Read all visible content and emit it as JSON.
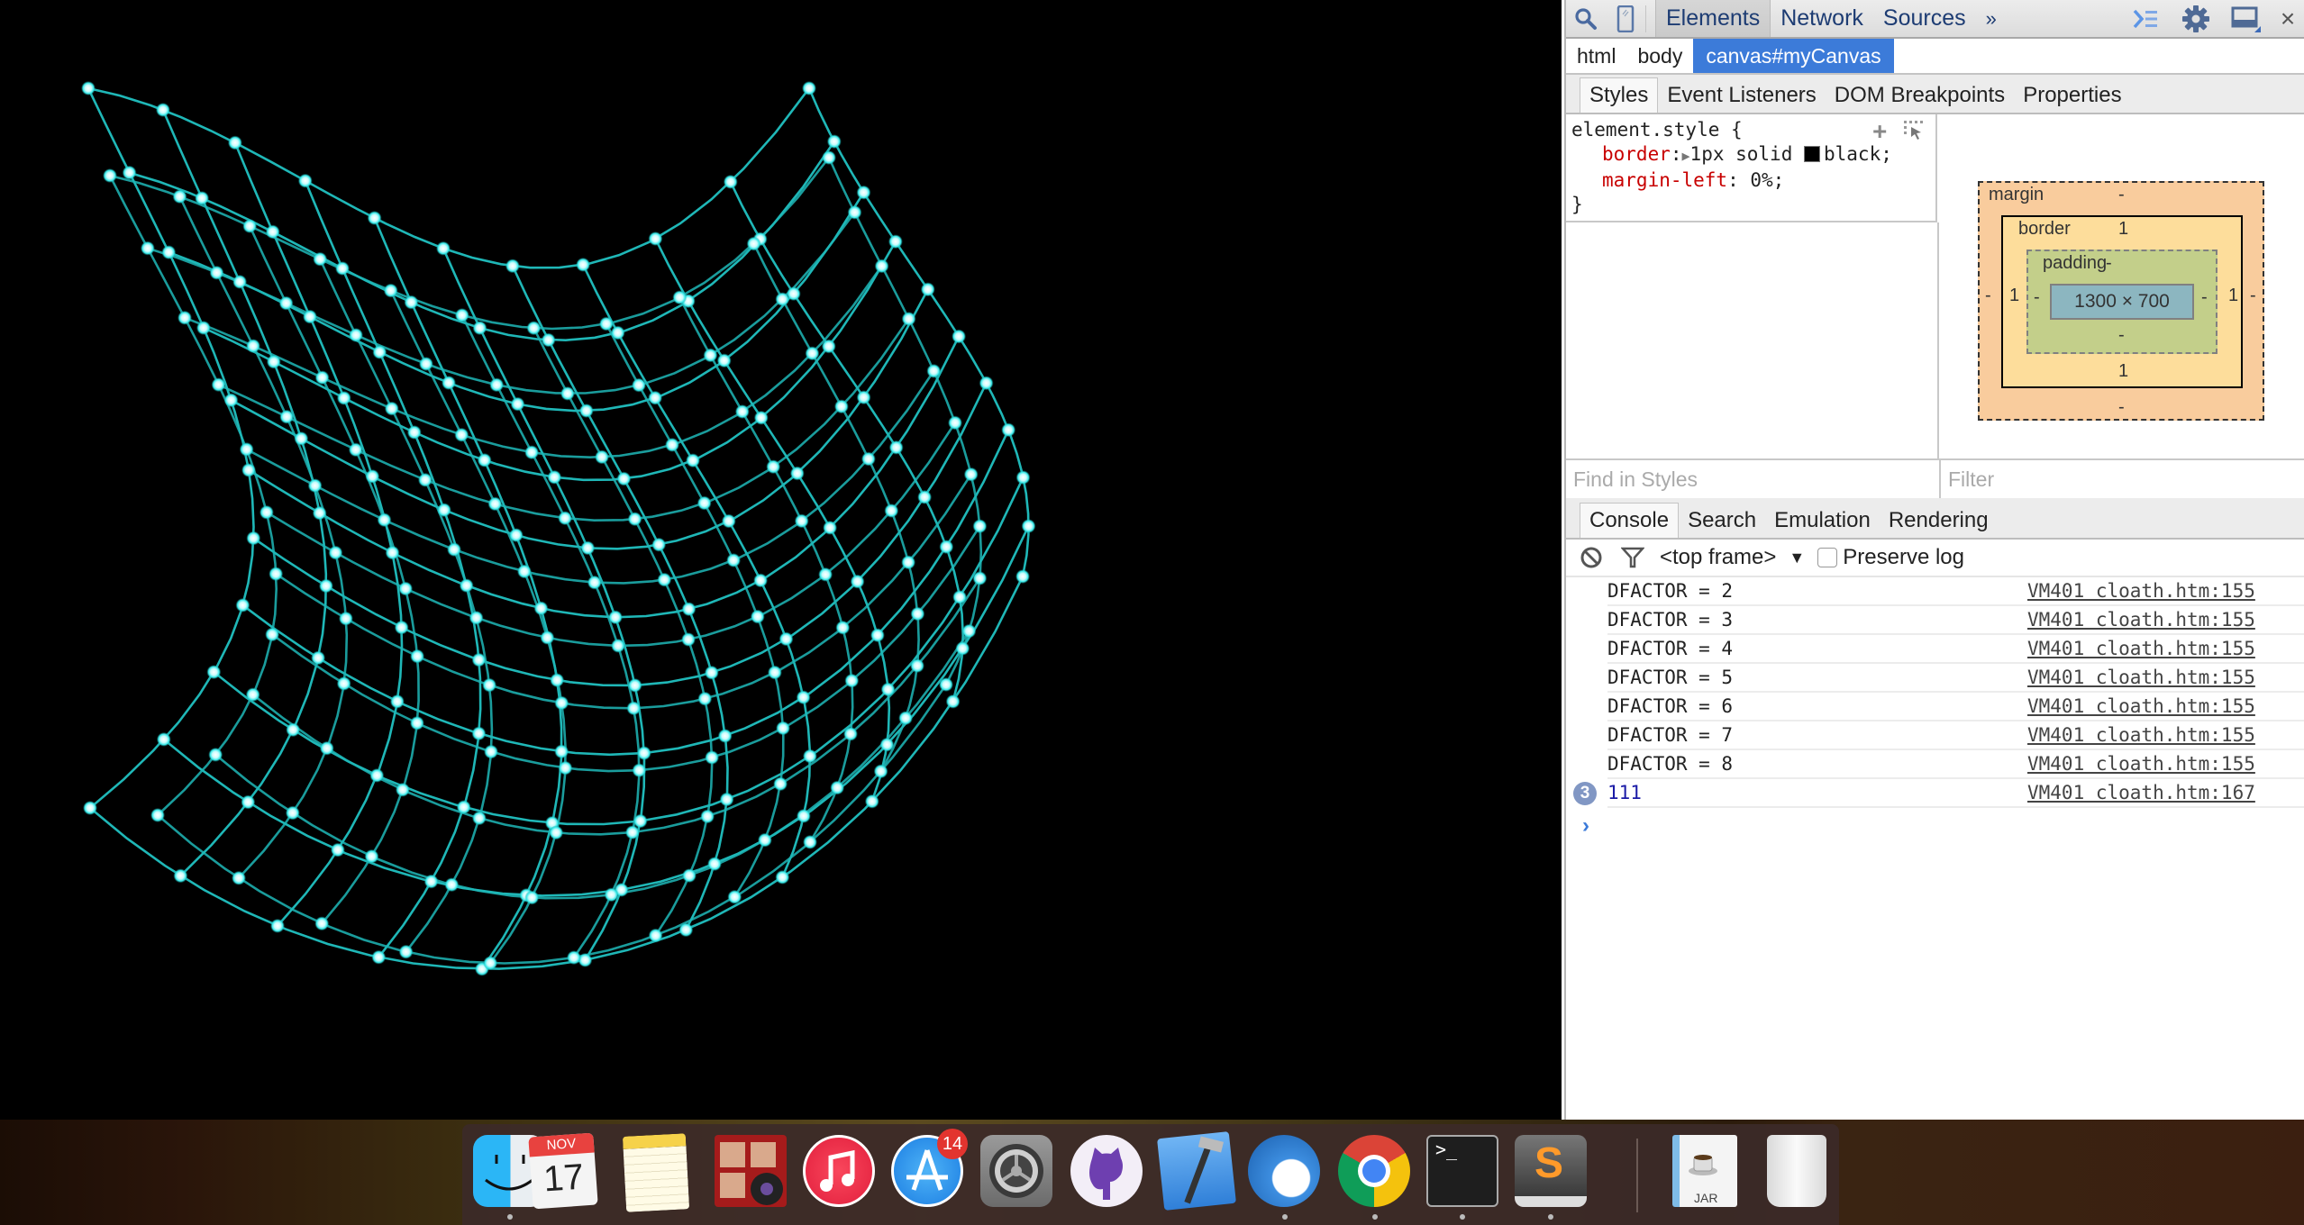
{
  "canvas": {
    "element_id": "myCanvas",
    "background": "#000000",
    "mesh_line_color": "#1fb7b7",
    "mesh_node_color": "#3ff0f0",
    "mesh_node_core": "#ffffff"
  },
  "devtools": {
    "toolbar": {
      "search_icon": "search-icon",
      "device_icon": "device-mode-icon",
      "tabs": [
        {
          "label": "Elements",
          "active": true
        },
        {
          "label": "Network",
          "active": false
        },
        {
          "label": "Sources",
          "active": false
        }
      ],
      "more_tabs": "»",
      "right_icons": [
        "console-drawer-icon",
        "gear-icon",
        "dock-side-icon",
        "close-icon"
      ],
      "close_label": "×"
    },
    "breadcrumbs": [
      {
        "label": "html",
        "active": false
      },
      {
        "label": "body",
        "active": false
      },
      {
        "label": "canvas#myCanvas",
        "active": true
      }
    ],
    "sidebar_tabs": [
      {
        "label": "Styles",
        "active": true
      },
      {
        "label": "Event Listeners",
        "active": false
      },
      {
        "label": "DOM Breakpoints",
        "active": false
      },
      {
        "label": "Properties",
        "active": false
      }
    ],
    "styles": {
      "selector": "element.style {",
      "rules": [
        {
          "name": "border",
          "value": "1px solid",
          "color_swatch": "#000000",
          "value_after": "black;"
        },
        {
          "name": "margin-left",
          "value": "0%;"
        }
      ],
      "closing": "}",
      "add_rule": "+",
      "find_placeholder": "Find in Styles"
    },
    "box_model": {
      "margin_label": "margin",
      "margin": {
        "top": "-",
        "right": "-",
        "bottom": "-",
        "left": "-"
      },
      "border_label": "border",
      "border": {
        "top": "1",
        "right": "1",
        "bottom": "1",
        "left": "1"
      },
      "padding_label": "padding",
      "padding": {
        "top": "-",
        "right": "-",
        "bottom": "-",
        "left": "-"
      },
      "content": "1300 × 700",
      "filter_placeholder": "Filter"
    },
    "drawer_tabs": [
      {
        "label": "Console",
        "active": true
      },
      {
        "label": "Search",
        "active": false
      },
      {
        "label": "Emulation",
        "active": false
      },
      {
        "label": "Rendering",
        "active": false
      }
    ],
    "console": {
      "frame": "<top frame>",
      "preserve_log": "Preserve log",
      "preserve_checked": false,
      "messages": [
        {
          "text": "DFACTOR = 2",
          "source": "VM401 cloath.htm:155"
        },
        {
          "text": "DFACTOR = 3",
          "source": "VM401 cloath.htm:155"
        },
        {
          "text": "DFACTOR = 4",
          "source": "VM401 cloath.htm:155"
        },
        {
          "text": "DFACTOR = 5",
          "source": "VM401 cloath.htm:155"
        },
        {
          "text": "DFACTOR = 6",
          "source": "VM401 cloath.htm:155"
        },
        {
          "text": "DFACTOR = 7",
          "source": "VM401 cloath.htm:155"
        },
        {
          "text": "DFACTOR = 8",
          "source": "VM401 cloath.htm:155"
        },
        {
          "text": "111",
          "source": "VM401 cloath.htm:167",
          "repeat": "3"
        }
      ],
      "prompt": "›"
    }
  },
  "dock": {
    "items": [
      {
        "name": "Finder",
        "icon": "finder-icon",
        "running": true
      },
      {
        "name": "Calendar",
        "icon": "calendar-icon",
        "month": "NOV",
        "day": "17",
        "running": false
      },
      {
        "name": "Notes",
        "icon": "notes-icon",
        "running": false
      },
      {
        "name": "Photo Booth",
        "icon": "photo-booth-icon",
        "running": false
      },
      {
        "name": "iTunes",
        "icon": "itunes-icon",
        "running": false
      },
      {
        "name": "App Store",
        "icon": "app-store-icon",
        "badge": "14",
        "running": false
      },
      {
        "name": "System Preferences",
        "icon": "system-preferences-icon",
        "running": false
      },
      {
        "name": "GitHub",
        "icon": "github-icon",
        "running": false
      },
      {
        "name": "Xcode",
        "icon": "xcode-icon",
        "running": false
      },
      {
        "name": "Thunderbird",
        "icon": "thunderbird-icon",
        "running": true
      },
      {
        "name": "Chrome",
        "icon": "chrome-icon",
        "running": true
      },
      {
        "name": "Terminal",
        "icon": "terminal-icon",
        "running": true
      },
      {
        "name": "Sublime Text",
        "icon": "sublime-text-icon",
        "running": true
      }
    ],
    "stack_items": [
      {
        "name": "JAR",
        "icon": "jar-file-icon",
        "label": "JAR"
      },
      {
        "name": "Trash",
        "icon": "trash-icon"
      }
    ]
  }
}
